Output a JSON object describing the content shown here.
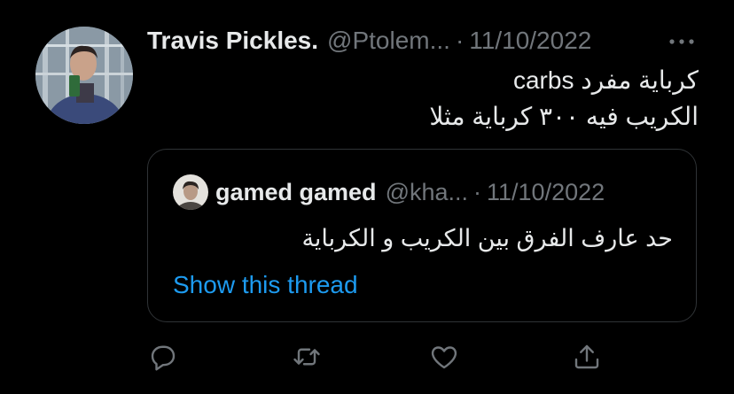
{
  "tweet": {
    "display_name": "Travis Pickles.",
    "handle": "@Ptolem...",
    "separator": "·",
    "date": "11/10/2022",
    "more_icon": "more-horizontal-icon",
    "text_lines": [
      "كرباية مفرد carbs",
      "الكريب فيه ٣٠٠ كرباية مثلا"
    ]
  },
  "quote": {
    "display_name": "gamed gamed",
    "handle": "@kha...",
    "separator": "·",
    "date": "11/10/2022",
    "text": "حد عارف الفرق بين الكريب و الكرباية",
    "show_thread_label": "Show this thread"
  },
  "actions": [
    {
      "icon": "reply-icon"
    },
    {
      "icon": "retweet-icon"
    },
    {
      "icon": "like-icon"
    },
    {
      "icon": "share-icon"
    }
  ],
  "colors": {
    "background": "#000000",
    "primary_text": "#e7e9ea",
    "secondary_text": "#71767b",
    "link": "#1d9bf0",
    "border": "#2f3336"
  }
}
